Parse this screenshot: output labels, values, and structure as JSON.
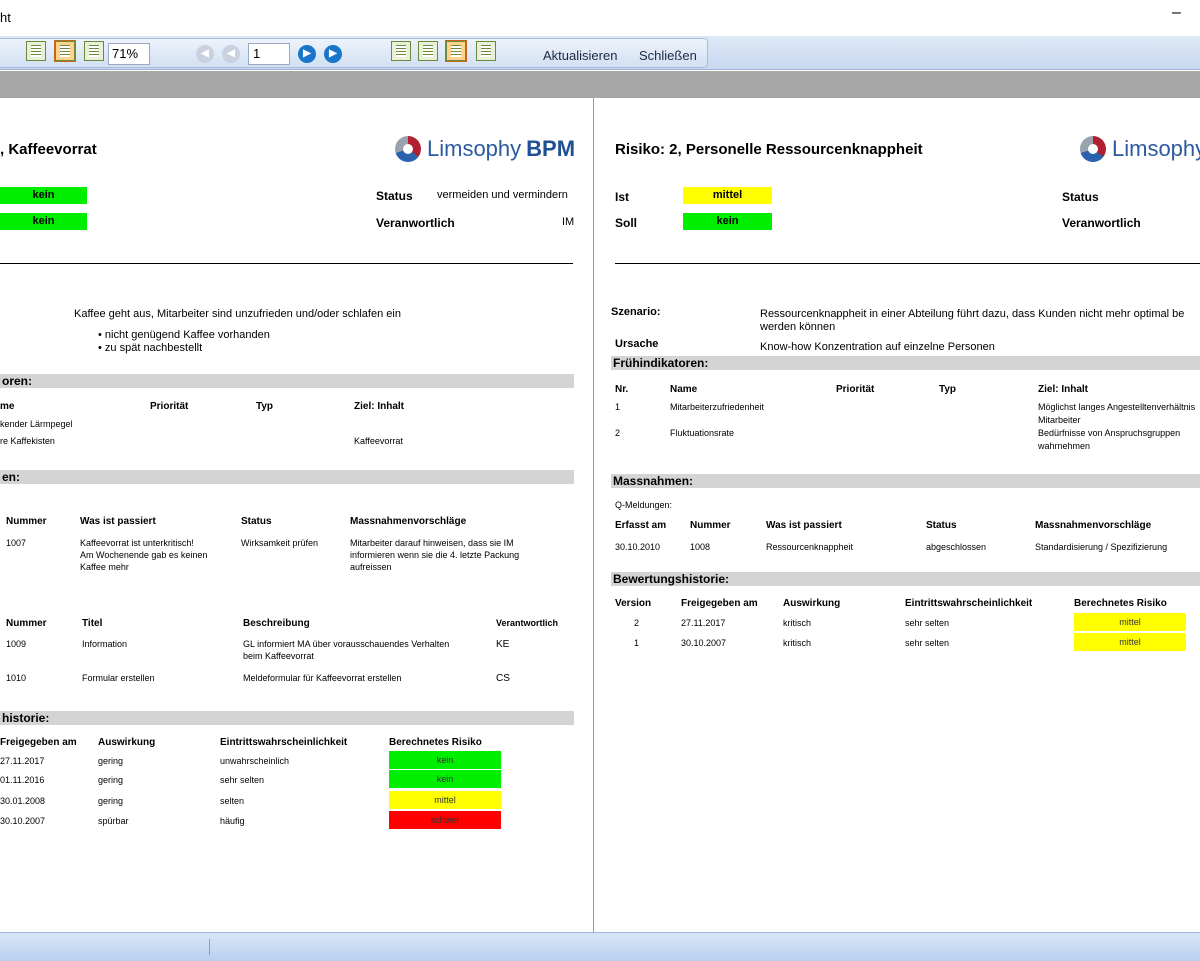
{
  "window": {
    "title": "ht",
    "minimize_glyph": "–"
  },
  "toolbar": {
    "zoom": "71%",
    "page": "1",
    "refresh_label": "Aktualisieren",
    "close_label": "Schließen"
  },
  "left": {
    "title": ", Kaffeevorrat",
    "ist_badge": "kein",
    "soll_badge": "kein",
    "status_label": "Status",
    "status_value": "vermeiden und vermindern",
    "verantwortlich_label": "Veranwortlich",
    "verantwortlich_value": "IM",
    "scenario": "Kaffee geht aus, Mitarbeiter sind unzufrieden und/oder schlafen ein",
    "bullets": [
      "nicht genügend Kaffee vorhanden",
      "zu spät nachbestellt"
    ],
    "fruehindikatoren_bar": "oren:",
    "fi_headers": {
      "name": "me",
      "prio": "Priorität",
      "typ": "Typ",
      "ziel": "Ziel: Inhalt"
    },
    "fi_rows": [
      {
        "name": "kender Lärmpegel",
        "ziel": ""
      },
      {
        "name": "re Kaffekisten",
        "ziel": "Kaffeevorrat"
      }
    ],
    "massnahmen_bar": "en:",
    "qm_headers": {
      "nummer": "Nummer",
      "was": "Was ist passiert",
      "status": "Status",
      "vorschlag": "Massnahmenvorschläge"
    },
    "qm_row": {
      "nummer": "1007",
      "was1": "Kaffeevorrat ist unterkritisch!",
      "was2": "Am Wochenende gab es keinen",
      "was3": "Kaffee mehr",
      "status": "Wirksamkeit prüfen",
      "v1": "Mitarbeiter darauf hinweisen, dass sie IM",
      "v2": "informieren wenn sie die 4. letzte Packung",
      "v3": "aufreissen"
    },
    "m_headers": {
      "nummer": "Nummer",
      "titel": "Titel",
      "beschreibung": "Beschreibung",
      "verantwortlich": "Verantwortlich"
    },
    "m_rows": [
      {
        "nummer": "1009",
        "titel": "Information",
        "b1": "GL informiert MA über vorausschauendes Verhalten",
        "b2": "beim Kaffeevorrat",
        "v": "KE"
      },
      {
        "nummer": "1010",
        "titel": "Formular erstellen",
        "b1": "Meldeformular für Kaffeevorrat erstellen",
        "b2": "",
        "v": "CS"
      }
    ],
    "historie_bar": "historie:",
    "h_headers": {
      "freigegeben": "Freigegeben am",
      "auswirkung": "Auswirkung",
      "ew": "Eintrittswahrscheinlichkeit",
      "risiko": "Berechnetes Risiko"
    },
    "h_rows": [
      {
        "date": "27.11.2017",
        "aus": "gering",
        "ew": "unwahrscheinlich",
        "risk": "kein",
        "color": "green"
      },
      {
        "date": "01.11.2016",
        "aus": "gering",
        "ew": "sehr selten",
        "risk": "kein",
        "color": "green"
      },
      {
        "date": "30.01.2008",
        "aus": "gering",
        "ew": "selten",
        "risk": "mittel",
        "color": "yellow"
      },
      {
        "date": "30.10.2007",
        "aus": "spürbar",
        "ew": "häufig",
        "risk": "schwer",
        "color": "red"
      }
    ]
  },
  "right": {
    "title": "Risiko: 2, Personelle Ressourcenknappheit",
    "ist_label": "Ist",
    "soll_label": "Soll",
    "ist_badge": "mittel",
    "soll_badge": "kein",
    "status_label": "Status",
    "verantwortlich_label": "Veranwortlich",
    "szenario_label": "Szenario:",
    "szenario_1": "Ressourcenknappheit in einer Abteilung führt dazu, dass Kunden nicht mehr optimal be",
    "szenario_2": "werden können",
    "ursache_label": "Ursache",
    "ursache": "Know-how Konzentration auf einzelne Personen",
    "fi_bar": "Frühindikatoren:",
    "fi_headers": {
      "nr": "Nr.",
      "name": "Name",
      "prio": "Priorität",
      "typ": "Typ",
      "ziel": "Ziel: Inhalt"
    },
    "fi_rows": [
      {
        "nr": "1",
        "name": "Mitarbeiterzufriedenheit",
        "z1": "Möglichst langes Angestelltenverhältnis",
        "z2": "Mitarbeiter"
      },
      {
        "nr": "2",
        "name": "Fluktuationsrate",
        "z1": "Bedürfnisse von Anspruchsgruppen",
        "z2": "wahrnehmen"
      }
    ],
    "massnahmen_bar": "Massnahmen:",
    "qmeldungen": "Q-Meldungen:",
    "qm_headers": {
      "erfasst": "Erfasst am",
      "nummer": "Nummer",
      "was": "Was ist passiert",
      "status": "Status",
      "vorschlag": "Massnahmenvorschläge"
    },
    "qm_row": {
      "erfasst": "30.10.2010",
      "nummer": "1008",
      "was": "Ressourcenknappheit",
      "status": "abgeschlossen",
      "vorschlag": "Standardisierung / Spezifizierung"
    },
    "historie_bar": "Bewertungshistorie:",
    "h_headers": {
      "version": "Version",
      "freigegeben": "Freigegeben am",
      "auswirkung": "Auswirkung",
      "ew": "Eintrittswahrscheinlichkeit",
      "risiko": "Berechnetes Risiko"
    },
    "h_rows": [
      {
        "version": "2",
        "date": "27.11.2017",
        "aus": "kritisch",
        "ew": "sehr selten",
        "risk": "mittel"
      },
      {
        "version": "1",
        "date": "30.10.2007",
        "aus": "kritisch",
        "ew": "sehr selten",
        "risk": "mittel"
      }
    ]
  },
  "logo": {
    "name": "Limsophy",
    "suffix": "BPM"
  },
  "colors": {
    "green": "#00ee00",
    "yellow": "#ffff00",
    "red": "#ff0000",
    "toolbar": "#c7d8f0"
  }
}
